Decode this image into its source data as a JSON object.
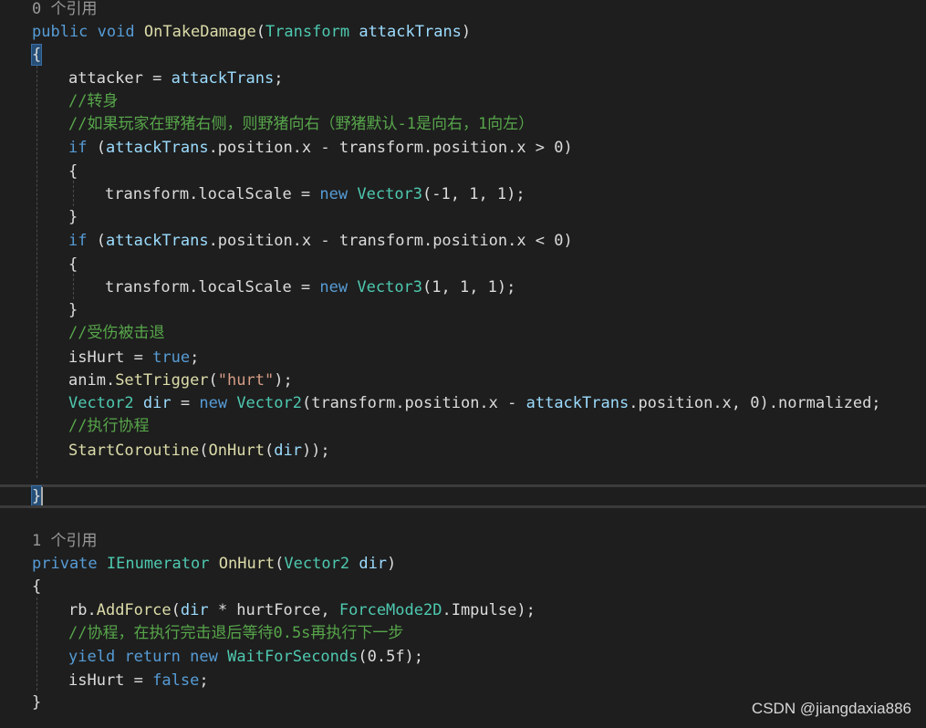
{
  "colors": {
    "background": "#1e1e1e",
    "keyword": "#569cd6",
    "type": "#4ec9b0",
    "method": "#dcdcaa",
    "parameter": "#9cdcfe",
    "plain": "#dcdcdc",
    "comment": "#57a64a",
    "string": "#d69d85",
    "codelens": "#999999"
  },
  "method1": {
    "codelens": "0 个引用",
    "sig": {
      "kw1": "public",
      "kw2": "void",
      "name": "OnTakeDamage",
      "paren_open": "(",
      "ptype": "Transform",
      "pname": "attackTrans",
      "paren_close": ")"
    },
    "open_brace": "{",
    "l_attacker": {
      "a": "attacker",
      "b": " = ",
      "c": "attackTrans",
      "d": ";"
    },
    "comment_turn": "//转身",
    "comment_if": "//如果玩家在野猪右侧，则野猪向右（野猪默认-1是向右，1向左）",
    "if1": {
      "kw": "if",
      "a": " (",
      "b": "attackTrans",
      "c": ".position.x - transform.position.x > 0)"
    },
    "if1_open": "{",
    "scale1": {
      "a": "transform.localScale = ",
      "kw": "new",
      "sp": " ",
      "type": "Vector3",
      "b": "(-1, 1, 1);"
    },
    "if1_close": "}",
    "if2": {
      "kw": "if",
      "a": " (",
      "b": "attackTrans",
      "c": ".position.x - transform.position.x < 0)"
    },
    "if2_open": "{",
    "scale2": {
      "a": "transform.localScale = ",
      "kw": "new",
      "sp": " ",
      "type": "Vector3",
      "b": "(1, 1, 1);"
    },
    "if2_close": "}",
    "comment_hurt": "//受伤被击退",
    "ishurt": {
      "a": "isHurt = ",
      "kw": "true",
      "b": ";"
    },
    "anim": {
      "a": "anim.",
      "method": "SetTrigger",
      "b": "(",
      "str": "\"hurt\"",
      "c": ");"
    },
    "dir": {
      "type1": "Vector2",
      "sp": " ",
      "var": "dir",
      "a": " = ",
      "kw": "new",
      "sp2": " ",
      "type2": "Vector2",
      "b": "(transform.position.x - ",
      "c": "attackTrans",
      "d": ".position.x, 0).normalized;"
    },
    "comment_coroutine": "//执行协程",
    "start": {
      "method": "StartCoroutine",
      "a": "(",
      "method2": "OnHurt",
      "b": "(",
      "param": "dir",
      "c": "));"
    },
    "close_brace": "}"
  },
  "method2": {
    "codelens": "1 个引用",
    "sig": {
      "kw": "private",
      "sp": " ",
      "type": "IEnumerator",
      "sp2": " ",
      "name": "OnHurt",
      "a": "(",
      "ptype": "Vector2",
      "sp3": " ",
      "pname": "dir",
      "b": ")"
    },
    "open_brace": "{",
    "rb": {
      "a": "rb.",
      "method": "AddForce",
      "b": "(",
      "param": "dir",
      "c": " * hurtForce, ",
      "type": "ForceMode2D",
      "d": ".Impulse);"
    },
    "comment": "//协程，在执行完击退后等待0.5s再执行下一步",
    "yield": {
      "kw1": "yield",
      "sp": " ",
      "kw2": "return",
      "sp2": " ",
      "kw3": "new",
      "sp3": " ",
      "type": "WaitForSeconds",
      "a": "(0.5f);"
    },
    "ishurt": {
      "a": "isHurt = ",
      "kw": "false",
      "b": ";"
    },
    "close_brace": "}"
  },
  "watermark": "CSDN @jiangdaxia886"
}
